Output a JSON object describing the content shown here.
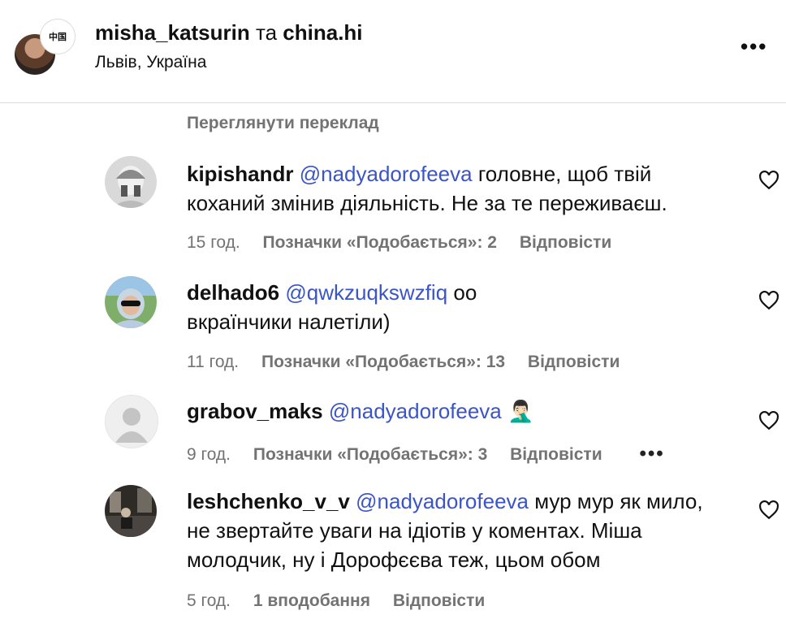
{
  "header": {
    "owner": "misha_katsurin",
    "separator": " та ",
    "collaborator": "china.hi",
    "location": "Львів, Україна",
    "avatar_badge": "中国"
  },
  "translate_link": "Переглянути переклад",
  "comments": [
    {
      "username": "kipishandr",
      "mention": "@nadyadorofeeva",
      "text_line1": " головне, щоб твій",
      "text_line2": "коханий змінив діяльність. Не за те переживаєш.",
      "time": "15 год.",
      "likes": "Позначки «Подобається»: 2",
      "reply": "Відповісти"
    },
    {
      "username": "delhado6",
      "mention": "@qwkzuqkswzfiq",
      "text_line1": " оо",
      "text_line2": "вкраїнчики налетіли)",
      "time": "11 год.",
      "likes": "Позначки «Подобається»: 13",
      "reply": "Відповісти"
    },
    {
      "username": "grabov_maks",
      "mention": "@nadyadorofeeva",
      "emoji": "🤦🏻‍♂️",
      "time": "9 год.",
      "likes": "Позначки «Подобається»: 3",
      "reply": "Відповісти",
      "more": "•••"
    },
    {
      "username": "leshchenko_v_v",
      "mention": "@nadyadorofeeva",
      "text_line1": " мур мур як мило,",
      "text_line2": "не звертайте уваги на ідіотів у коментах. Міша",
      "text_line3": "молодчик, ну і Дорофєєва теж, цьом обом",
      "time": "5 год.",
      "likes": "1 вподобання",
      "reply": "Відповісти"
    }
  ],
  "icons": {
    "more": "more-horizontal-icon",
    "like": "heart-outline-icon"
  },
  "colors": {
    "mention": "#3b55c9",
    "muted": "#737373",
    "divider": "#dbdbdb"
  }
}
